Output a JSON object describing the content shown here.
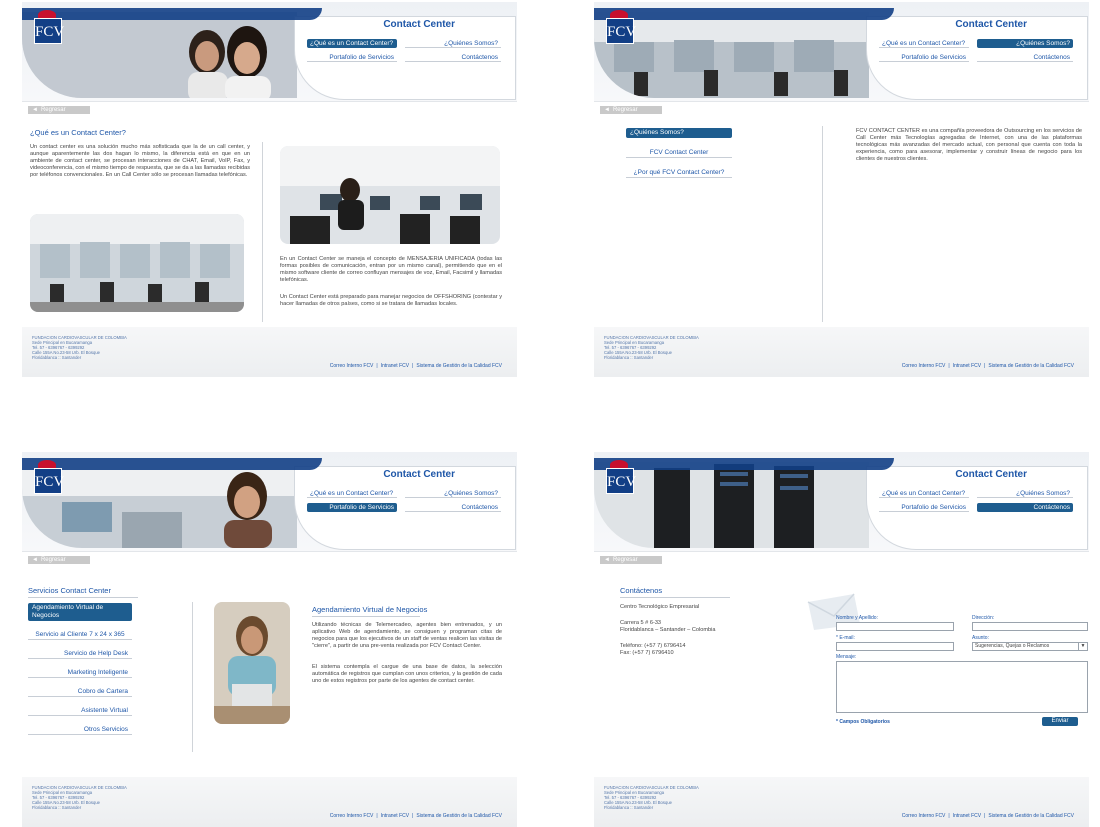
{
  "logo": "FCV",
  "site_title": "Contact Center",
  "nav": {
    "que_es": "¿Qué es un Contact Center?",
    "quienes": "¿Quiénes Somos?",
    "portafolio": "Portafolio de Servicios",
    "contactenos": "Contáctenos"
  },
  "back": "Regresar",
  "footer": {
    "lines": [
      "FUNDACION CARDIOVASCULAR DE COLOMBIA",
      "Sede Principal en Bucaramanga",
      "Tel. 57 - 6396767 - 6399292",
      "Calle 155A No.23-58 Urb. El Bosque",
      "Floridablanca :: Santander"
    ],
    "links": [
      "Correo Interno FCV",
      "Intranet FCV",
      "Sistema de Gestión de la Calidad FCV"
    ]
  },
  "p1": {
    "heading": "¿Qué es un Contact Center?",
    "para1": "Un contact center es una solución mucho más sofisticada que la de un call center, y aunque aparentemente las dos hagan lo mismo, la diferencia está en que en un ambiente de contact center, se procesan interacciones de CHAT, Email, VoIP, Fax, y videoconferencia, con el mismo tiempo de respuesta, que se da a las llamadas recibidas por teléfonos convencionales. En un Call Center sólo se procesan llamadas telefónicas.",
    "para2": "En un Contact Center se maneja el concepto de MENSAJERIA UNIFICADA (todas las formas posibles de comunicación, entran por un mismo canal), permitiendo que en el mismo software cliente de correo confluyan mensajes de voz, Email, Facsimil y llamadas telefónicas.",
    "para3": "Un Contact Center está preparado para manejar negocios de OFFSHORING (contestar y hacer llamadas de otros países, como si se tratara de llamadas locales."
  },
  "p2": {
    "side": [
      "¿Quiénes Somos?",
      "FCV Contact Center",
      "¿Por qué FCV Contact Center?"
    ],
    "para": "FCV CONTACT CENTER es una compañía proveedora de Outsourcing en los servicios de Call Center más Tecnologías agregadas de Internet, con una de las plataformas tecnológicas más avanzadas del mercado actual, con personal que cuenta con toda la experiencia, como para asesorar, implementar y construir líneas de negocio para los clientes de nuestros clientes."
  },
  "p3": {
    "section": "Servicios Contact Center",
    "side": [
      "Agendamiento Virtual de Negocios",
      "Servicio al Cliente 7 x 24 x 365",
      "Servicio de Help Desk",
      "Marketing Inteligente",
      "Cobro de Cartera",
      "Asistente Virtual",
      "Otros Servicios"
    ],
    "heading": "Agendamiento Virtual de Negocios",
    "para1": "Utilizando técnicas de Telemercadeo, agentes bien entrenados, y un aplicativo Web de agendamiento, se consiguen y programan citas de negocios para que los ejecutivos de un staff de ventas realicen las visitas de \"cierre\", a partir de una pre-venta realizada por FCV Contact Center.",
    "para2": "El sistema contempla el cargue de una base de datos, la selección automática de registros que cumplan con unos criterios, y la gestión de cada uno de estos registros por parte de los agentes de contact center."
  },
  "p4": {
    "heading": "Contáctenos",
    "place": "Centro Tecnológico Empresarial",
    "addr1": "Carrera 5 # 6-33",
    "addr2": "Floridablanca – Santander – Colombia",
    "tel": "Teléfono: (+57 7) 6796414",
    "fax": "Fax: (+57 7) 6796410",
    "form": {
      "nombre": "Nombre y Apellido:",
      "direccion": "Dirección:",
      "email": "* E-mail:",
      "asunto": "Asunto:",
      "asunto_value": "Sugerencias, Quejas o Reclamos",
      "mensaje": "Mensaje:",
      "required": "* Campos Obligatorios",
      "submit": "Enviar"
    }
  },
  "colors": {
    "brand": "#123f86",
    "accent": "#1e5d8f",
    "heart": "#c8102e"
  }
}
